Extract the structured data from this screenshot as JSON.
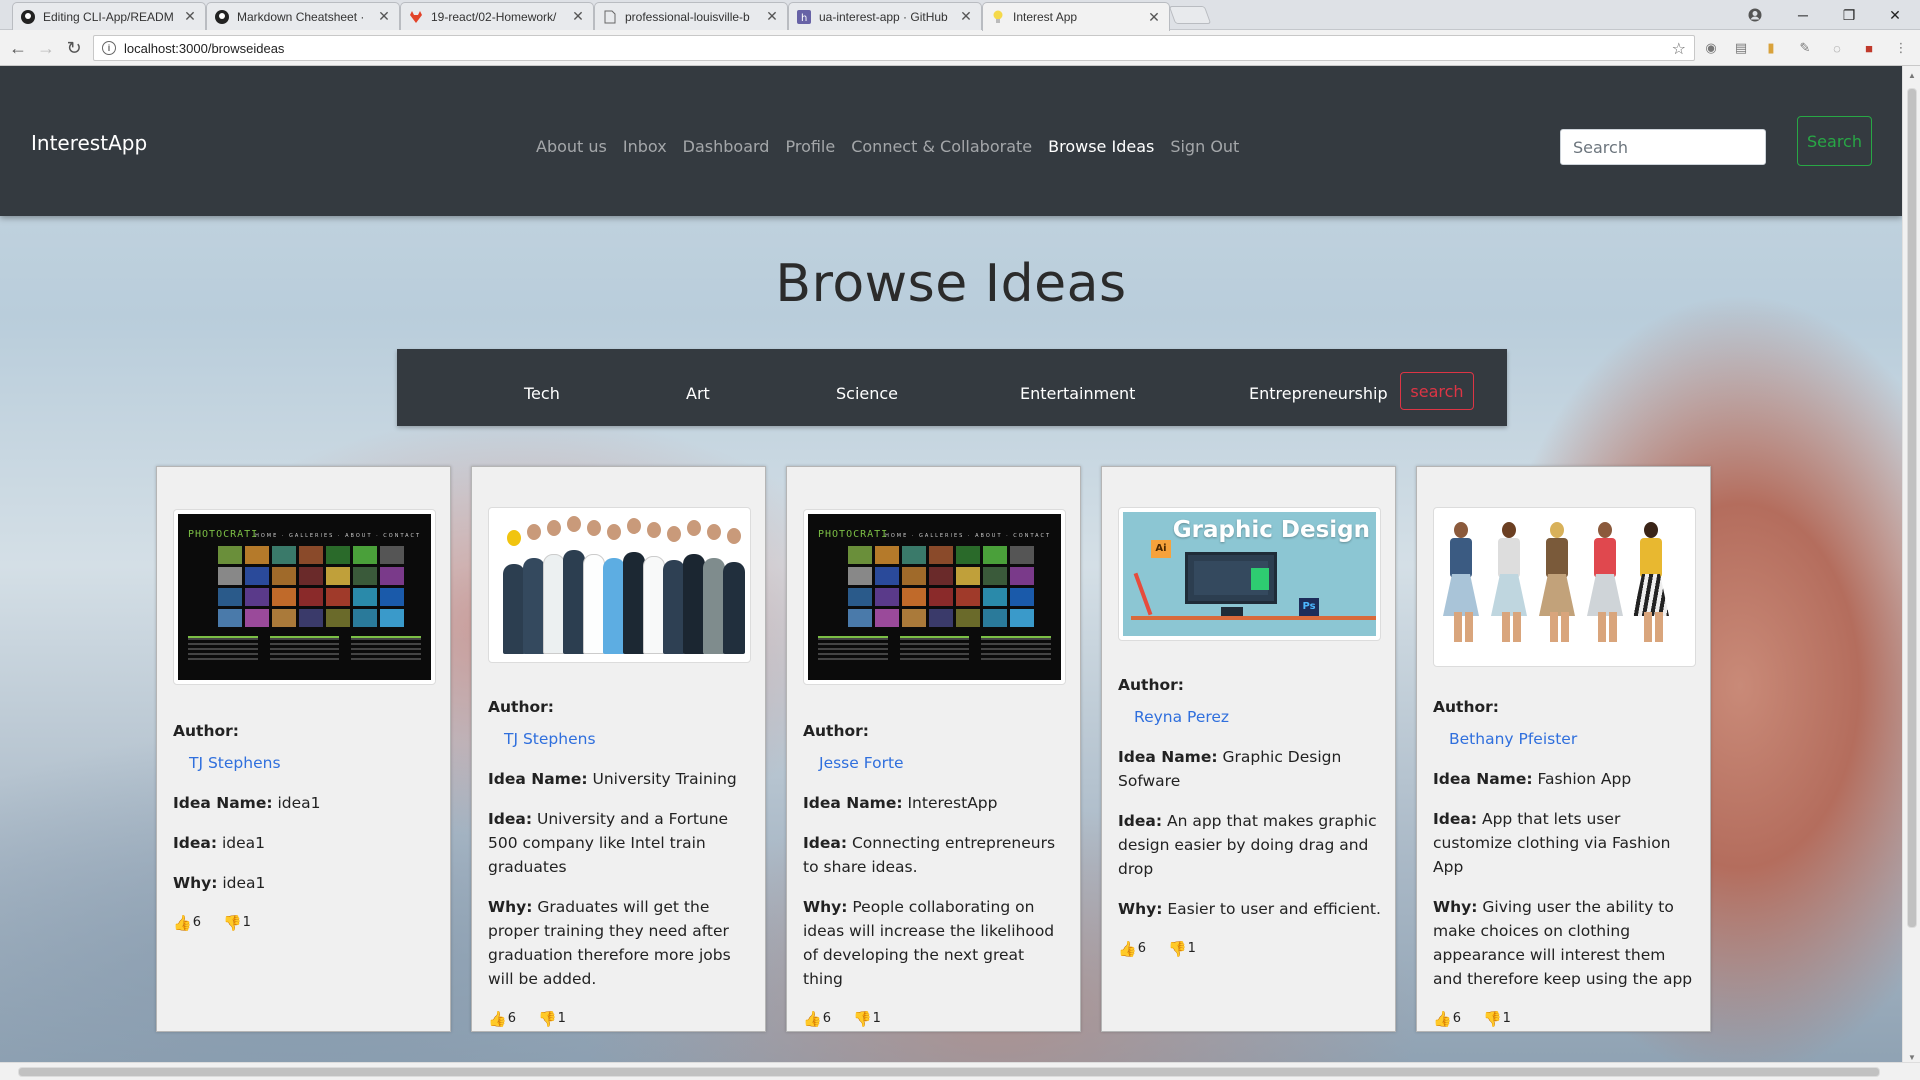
{
  "browser": {
    "tabs": [
      {
        "title": "Editing CLI-App/READM",
        "active": false
      },
      {
        "title": "Markdown Cheatsheet ·",
        "active": false
      },
      {
        "title": "19-react/02-Homework/",
        "active": false
      },
      {
        "title": "professional-louisville-b",
        "active": false
      },
      {
        "title": "ua-interest-app · GitHub",
        "active": false
      },
      {
        "title": "Interest App",
        "active": true
      }
    ],
    "url": "localhost:3000/browseideas"
  },
  "navbar": {
    "brand": "InterestApp",
    "links": [
      {
        "label": "About us",
        "active": false
      },
      {
        "label": "Inbox",
        "active": false
      },
      {
        "label": "Dashboard",
        "active": false
      },
      {
        "label": "Profile",
        "active": false
      },
      {
        "label": "Connect & Collaborate",
        "active": false
      },
      {
        "label": "Browse Ideas",
        "active": true
      },
      {
        "label": "Sign Out",
        "active": false
      }
    ],
    "search_placeholder": "Search",
    "search_button": "Search",
    "search_button_color": "#28a745"
  },
  "page": {
    "title": "Browse Ideas",
    "categories": [
      "Tech",
      "Art",
      "Science",
      "Entertainment",
      "Entrepreneurship"
    ],
    "category_search_button": "search",
    "category_search_color": "#dc3545"
  },
  "labels": {
    "author": "Author:",
    "idea_name": "Idea Name:",
    "idea": "Idea:",
    "why": "Why:"
  },
  "ideas": [
    {
      "image": "photocrati-website-screenshot",
      "author": "TJ Stephens",
      "idea_name": "idea1",
      "idea": "idea1",
      "why": "idea1",
      "likes": "6",
      "dislikes": "1"
    },
    {
      "image": "group-of-professionals-photo",
      "author": "TJ Stephens",
      "idea_name": "University Training",
      "idea": "University and a Fortune 500 company like Intel train graduates",
      "why": "Graduates will get the proper training they need after graduation therefore more jobs will be added.",
      "likes": "6",
      "dislikes": "1"
    },
    {
      "image": "photocrati-website-screenshot",
      "author": "Jesse Forte",
      "idea_name": "InterestApp",
      "idea": "Connecting entrepreneurs to share ideas.",
      "why": "People collaborating on ideas will increase the likelihood of developing the next great thing",
      "likes": "6",
      "dislikes": "1"
    },
    {
      "image": "graphic-design-illustration",
      "image_text": "Graphic Design",
      "author": "Reyna Perez",
      "idea_name": "Graphic Design Sofware",
      "idea": "An app that makes graphic design easier by doing drag and drop",
      "why": "Easier to user and efficient.",
      "likes": "6",
      "dislikes": "1"
    },
    {
      "image": "fashion-sketch-illustration",
      "author": "Bethany Pfeister",
      "idea_name": "Fashion App",
      "idea": "App that lets user customize clothing via Fashion App",
      "why": "Giving user the ability to make choices on clothing appearance will interest them and therefore keep using the app",
      "likes": "6",
      "dislikes": "1"
    }
  ]
}
